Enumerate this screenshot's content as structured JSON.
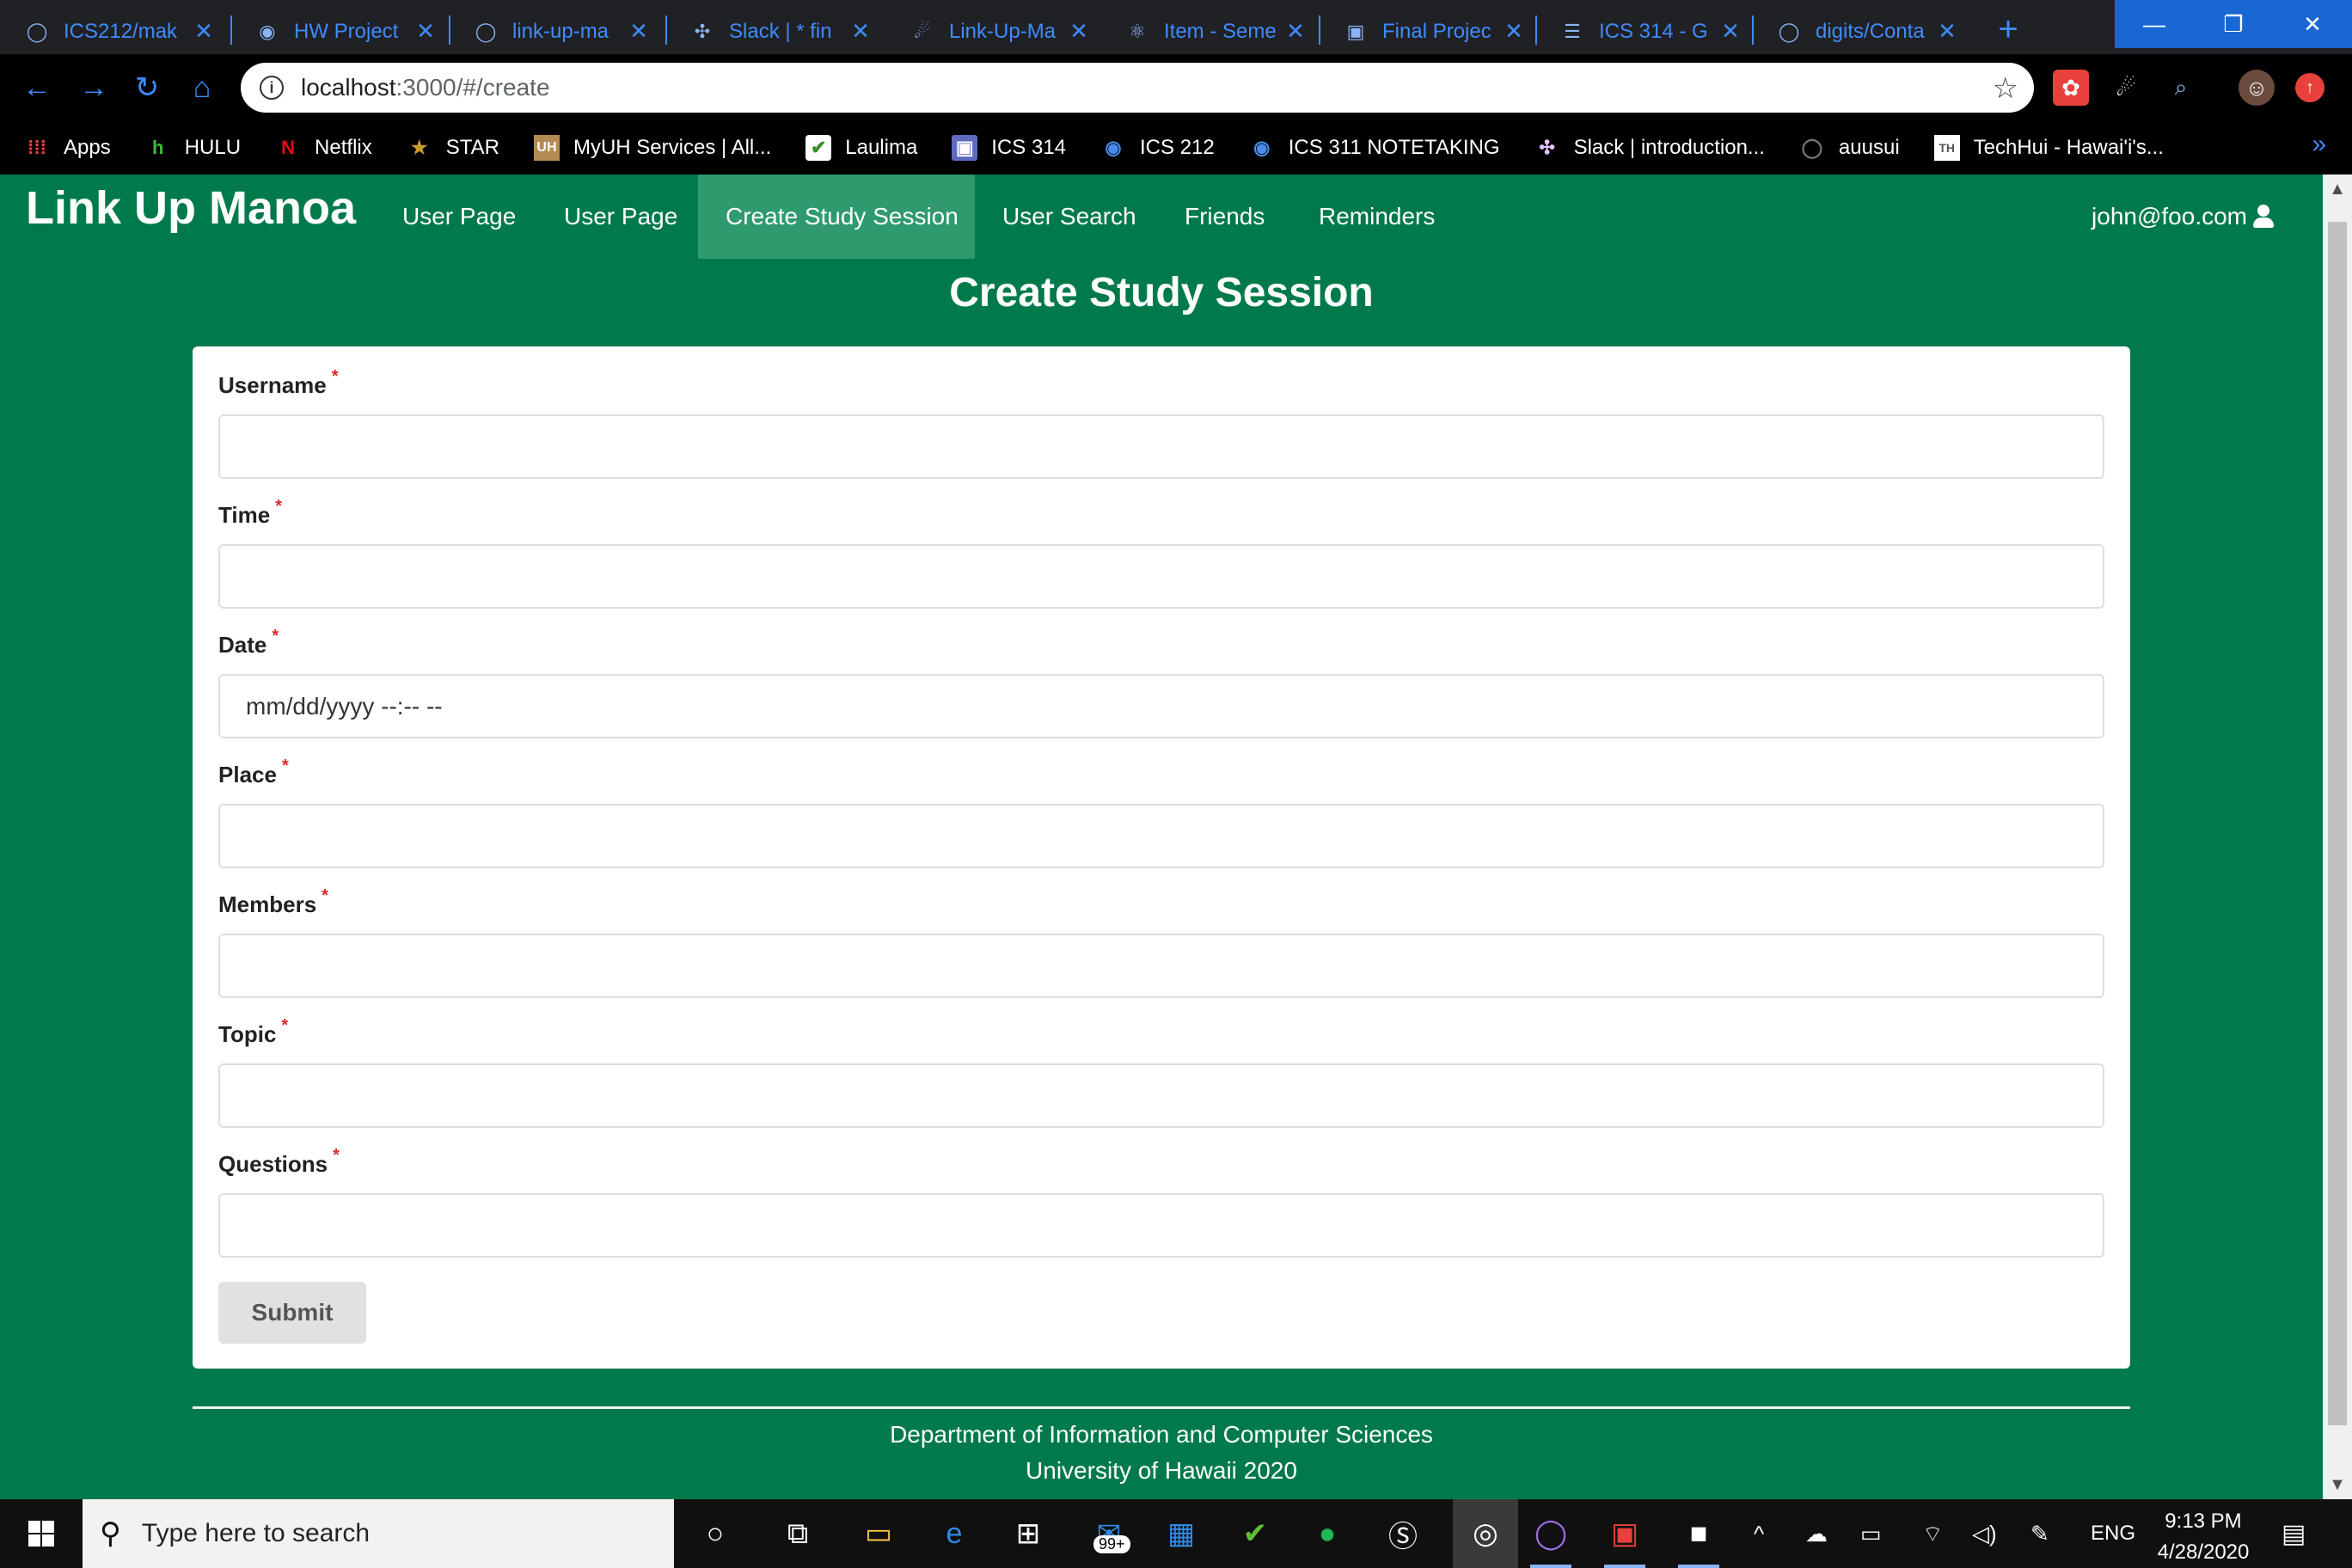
{
  "browser": {
    "tabs": [
      {
        "title": "ICS212/mak",
        "icon": "github-icon"
      },
      {
        "title": "HW Project",
        "icon": "globe-icon"
      },
      {
        "title": "link-up-ma",
        "icon": "github-icon"
      },
      {
        "title": "Slack | * fin",
        "icon": "slack-icon"
      },
      {
        "title": "Link-Up-Ma",
        "icon": "meteor-icon"
      },
      {
        "title": "Item - Seme",
        "icon": "react-icon"
      },
      {
        "title": "Final Projec",
        "icon": "page-icon"
      },
      {
        "title": "ICS 314 - G",
        "icon": "list-icon"
      },
      {
        "title": "digits/Conta",
        "icon": "github-icon"
      }
    ],
    "address": {
      "host": "localhost",
      "path": ":3000/#/create"
    },
    "bookmarks": [
      {
        "label": "Apps",
        "icon": "apps-grid-icon"
      },
      {
        "label": "HULU",
        "icon": "hulu-icon"
      },
      {
        "label": "Netflix",
        "icon": "netflix-icon"
      },
      {
        "label": "STAR",
        "icon": "star-icon"
      },
      {
        "label": "MyUH Services | All...",
        "icon": "uh-icon"
      },
      {
        "label": "Laulima",
        "icon": "laulima-icon"
      },
      {
        "label": "ICS 314",
        "icon": "page-icon"
      },
      {
        "label": "ICS 212",
        "icon": "globe-icon"
      },
      {
        "label": "ICS 311 NOTETAKING",
        "icon": "globe-icon"
      },
      {
        "label": "Slack | introduction...",
        "icon": "slack-icon"
      },
      {
        "label": "auusui",
        "icon": "github-icon"
      },
      {
        "label": "TechHui - Hawai'i's...",
        "icon": "techhui-icon"
      }
    ]
  },
  "app": {
    "brand": "Link Up Manoa",
    "nav": [
      {
        "label": "User Page",
        "active": false
      },
      {
        "label": "User Page",
        "active": false
      },
      {
        "label": "Create Study Session",
        "active": true
      },
      {
        "label": "User Search",
        "active": false
      },
      {
        "label": "Friends",
        "active": false
      },
      {
        "label": "Reminders",
        "active": false
      }
    ],
    "user": "john@foo.com",
    "page_title": "Create Study Session",
    "form": {
      "fields": [
        {
          "label": "Username",
          "required": true,
          "value": "",
          "placeholder": ""
        },
        {
          "label": "Time",
          "required": true,
          "value": "",
          "placeholder": ""
        },
        {
          "label": "Date",
          "required": true,
          "value": "",
          "placeholder": "mm/dd/yyyy --:-- --"
        },
        {
          "label": "Place",
          "required": true,
          "value": "",
          "placeholder": ""
        },
        {
          "label": "Members",
          "required": true,
          "value": "",
          "placeholder": ""
        },
        {
          "label": "Topic",
          "required": true,
          "value": "",
          "placeholder": ""
        },
        {
          "label": "Questions",
          "required": true,
          "value": "",
          "placeholder": ""
        }
      ],
      "required_marker": "*",
      "submit_label": "Submit"
    },
    "footer": {
      "line1": "Department of Information and Computer Sciences",
      "line2": "University of Hawaii 2020"
    }
  },
  "taskbar": {
    "search_placeholder": "Type here to search",
    "mail_badge": "99+",
    "language": "ENG",
    "time": "9:13 PM",
    "date": "4/28/2020"
  },
  "colors": {
    "page_bg": "#007a4b",
    "nav_active": "#2e9a6e",
    "required": "#db2828",
    "tab_text": "#3e8bff"
  }
}
